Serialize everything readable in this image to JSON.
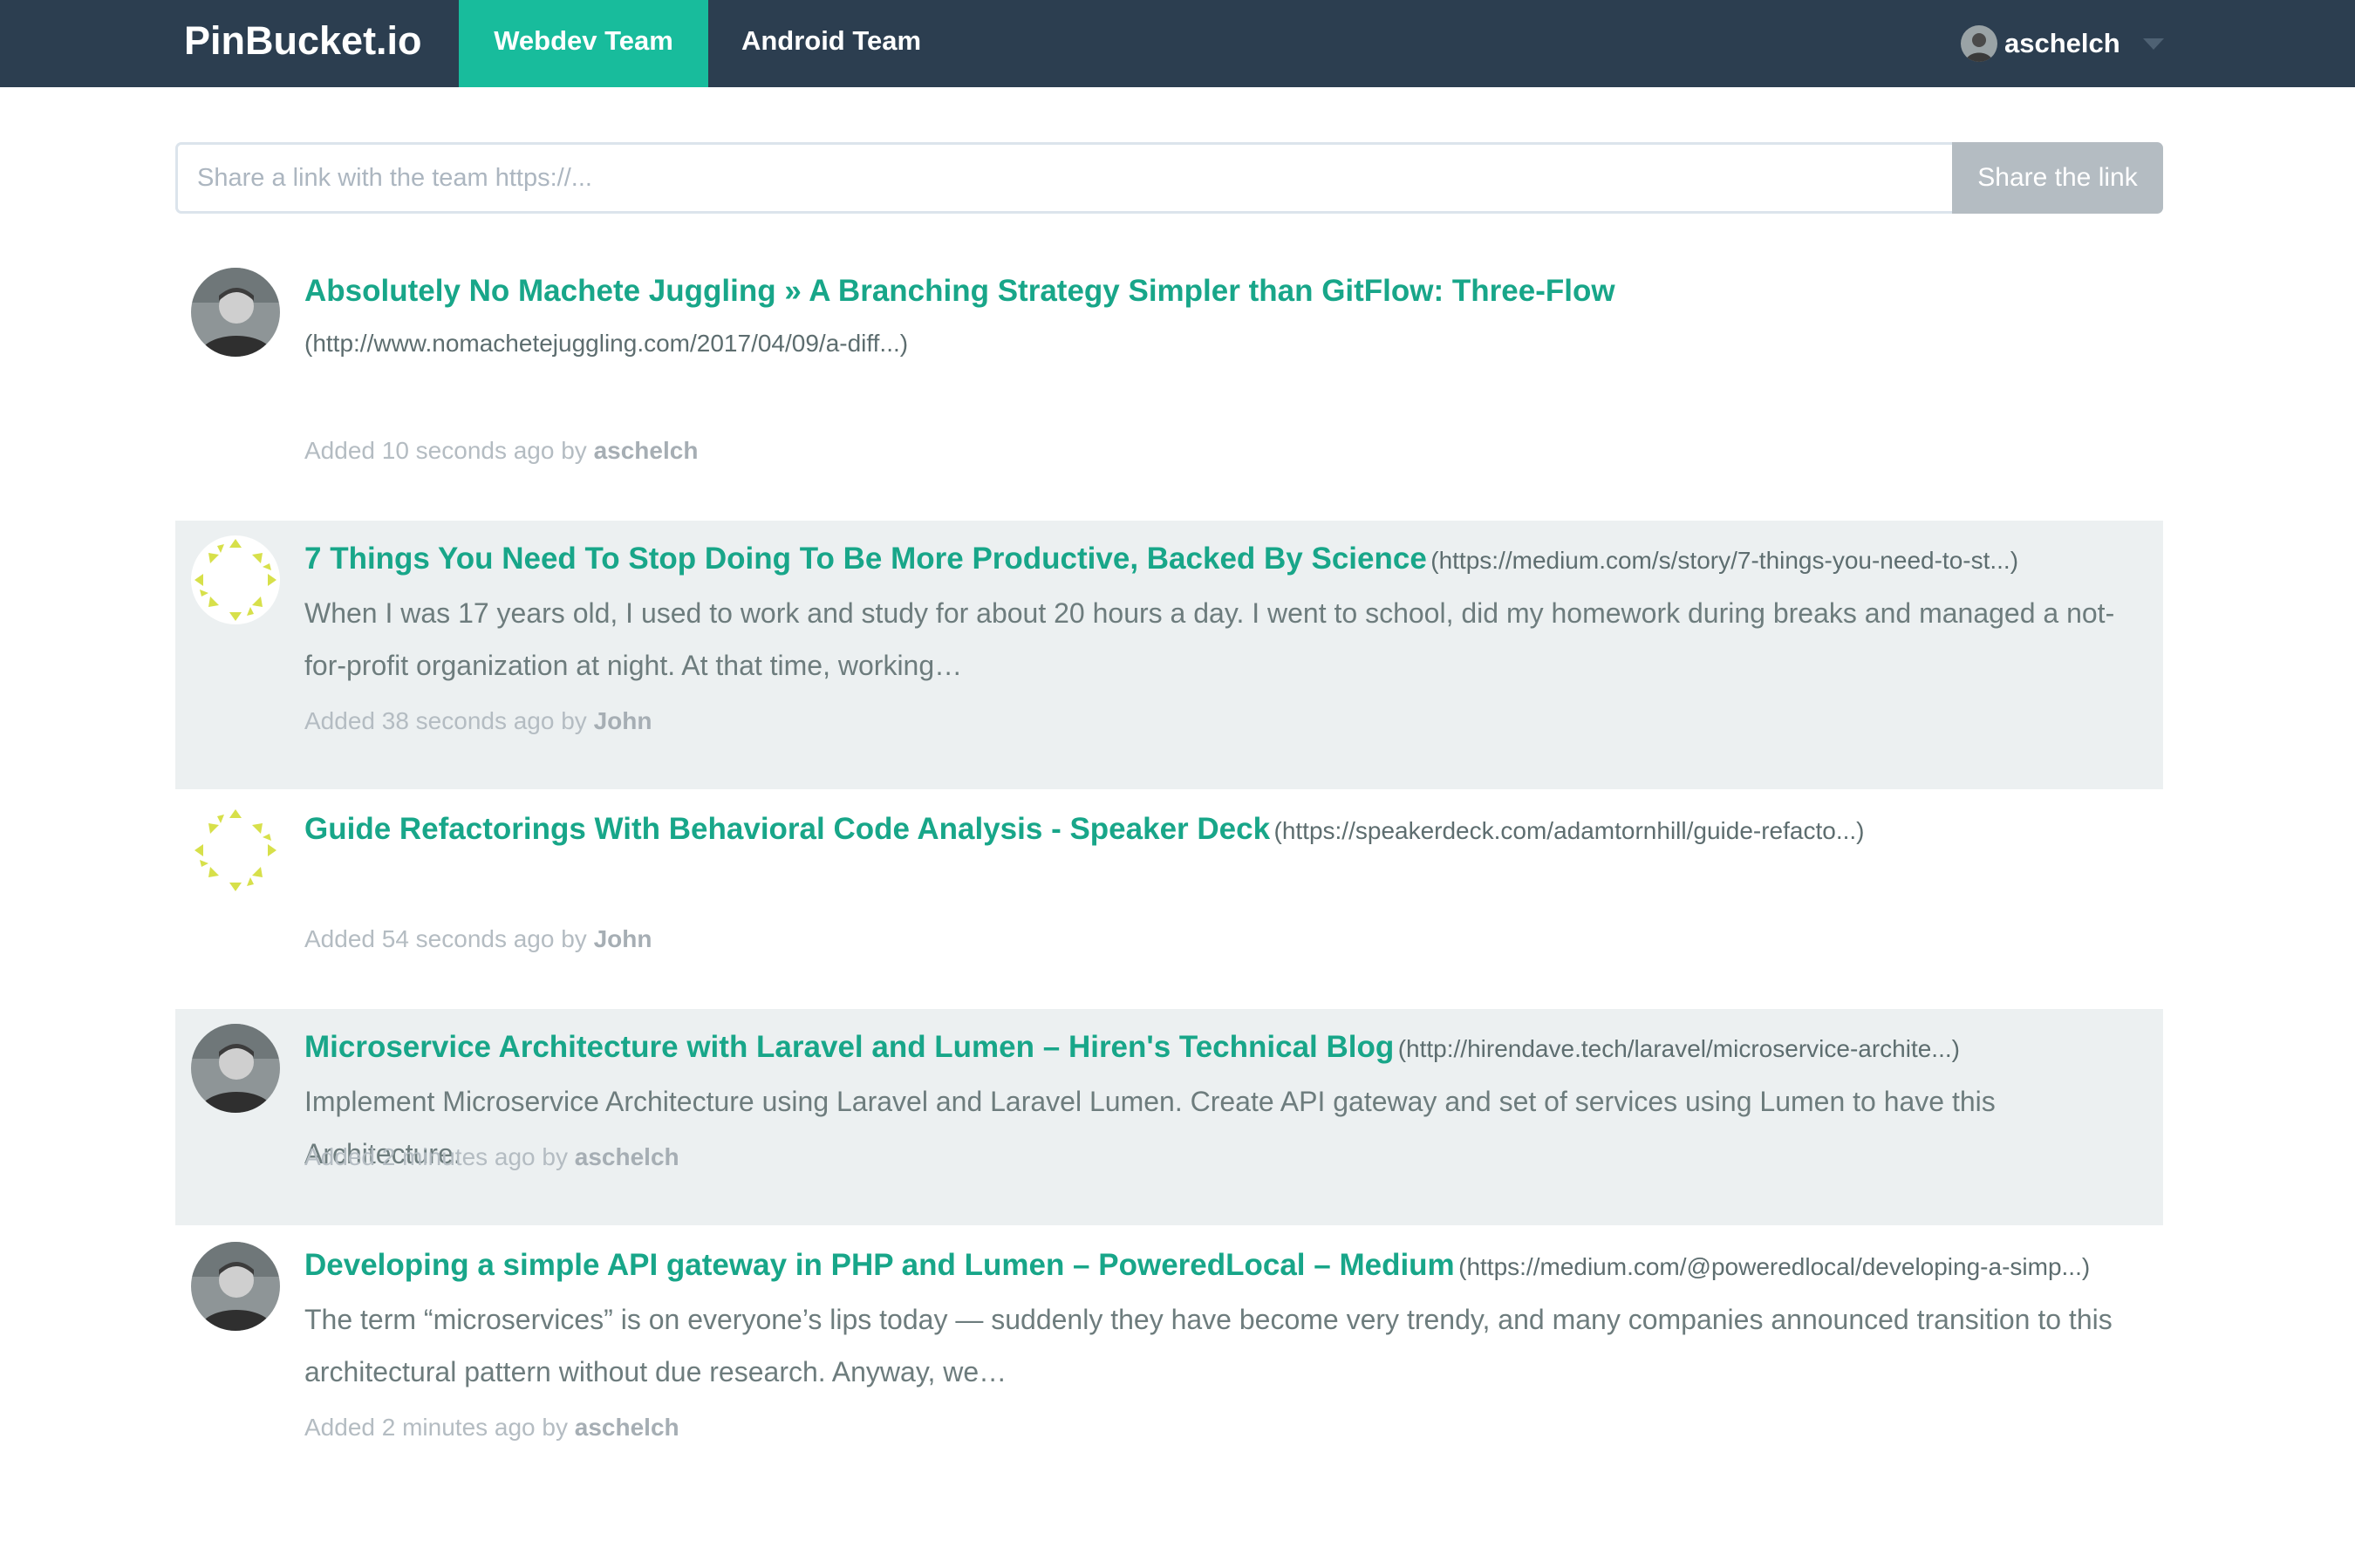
{
  "navbar": {
    "brand": "PinBucket.io",
    "tabs": [
      {
        "label": "Webdev Team",
        "active": true
      },
      {
        "label": "Android Team",
        "active": false
      }
    ],
    "user": {
      "name": "aschelch"
    }
  },
  "share": {
    "placeholder": "Share a link with the team https://...",
    "button_label": "Share the link"
  },
  "colors": {
    "navbar": "#2c3e50",
    "accent": "#18bc9c",
    "link_title": "#18a689",
    "alt_row": "#ecf0f1"
  },
  "links": [
    {
      "title": "Absolutely No Machete Juggling » A Branching Strategy Simpler than GitFlow: Three-Flow",
      "url": "(http://www.nomachetejuggling.com/2017/04/09/a-diff...)",
      "description": "",
      "meta_prefix": "Added 10 seconds ago by",
      "author": "aschelch",
      "avatar_icon": "user-photo-avatar"
    },
    {
      "title": "7 Things You Need To Stop Doing To Be More Productive, Backed By Science",
      "url": "(https://medium.com/s/story/7-things-you-need-to-st...)",
      "description": "When I was 17 years old, I used to work and study for about 20 hours a day. I went to school, did my homework during breaks and managed a not-for-profit organization at night. At that time, working…",
      "meta_prefix": "Added 38 seconds ago by",
      "author": "John",
      "avatar_icon": "identicon-avatar"
    },
    {
      "title": "Guide Refactorings With Behavioral Code Analysis - Speaker Deck",
      "url": "(https://speakerdeck.com/adamtornhill/guide-refacto...)",
      "description": "",
      "meta_prefix": "Added 54 seconds ago by",
      "author": "John",
      "avatar_icon": "identicon-avatar"
    },
    {
      "title": "Microservice Architecture with Laravel and Lumen – Hiren's Technical Blog",
      "url": "(http://hirendave.tech/laravel/microservice-archite...)",
      "description": "Implement Microservice Architecture using Laravel and Laravel Lumen. Create API gateway and set of services using Lumen to have this Architecture.",
      "meta_prefix": "Added 2 minutes ago by",
      "author": "aschelch",
      "avatar_icon": "user-photo-avatar"
    },
    {
      "title": "Developing a simple API gateway in PHP and Lumen – PoweredLocal – Medium",
      "url": "(https://medium.com/@poweredlocal/developing-a-simp...)",
      "description": "The term “microservices” is on everyone’s lips today — suddenly they have become very trendy, and many companies announced transition to this architectural pattern without due research. Anyway, we…",
      "meta_prefix": "Added 2 minutes ago by",
      "author": "aschelch",
      "avatar_icon": "user-photo-avatar"
    }
  ]
}
